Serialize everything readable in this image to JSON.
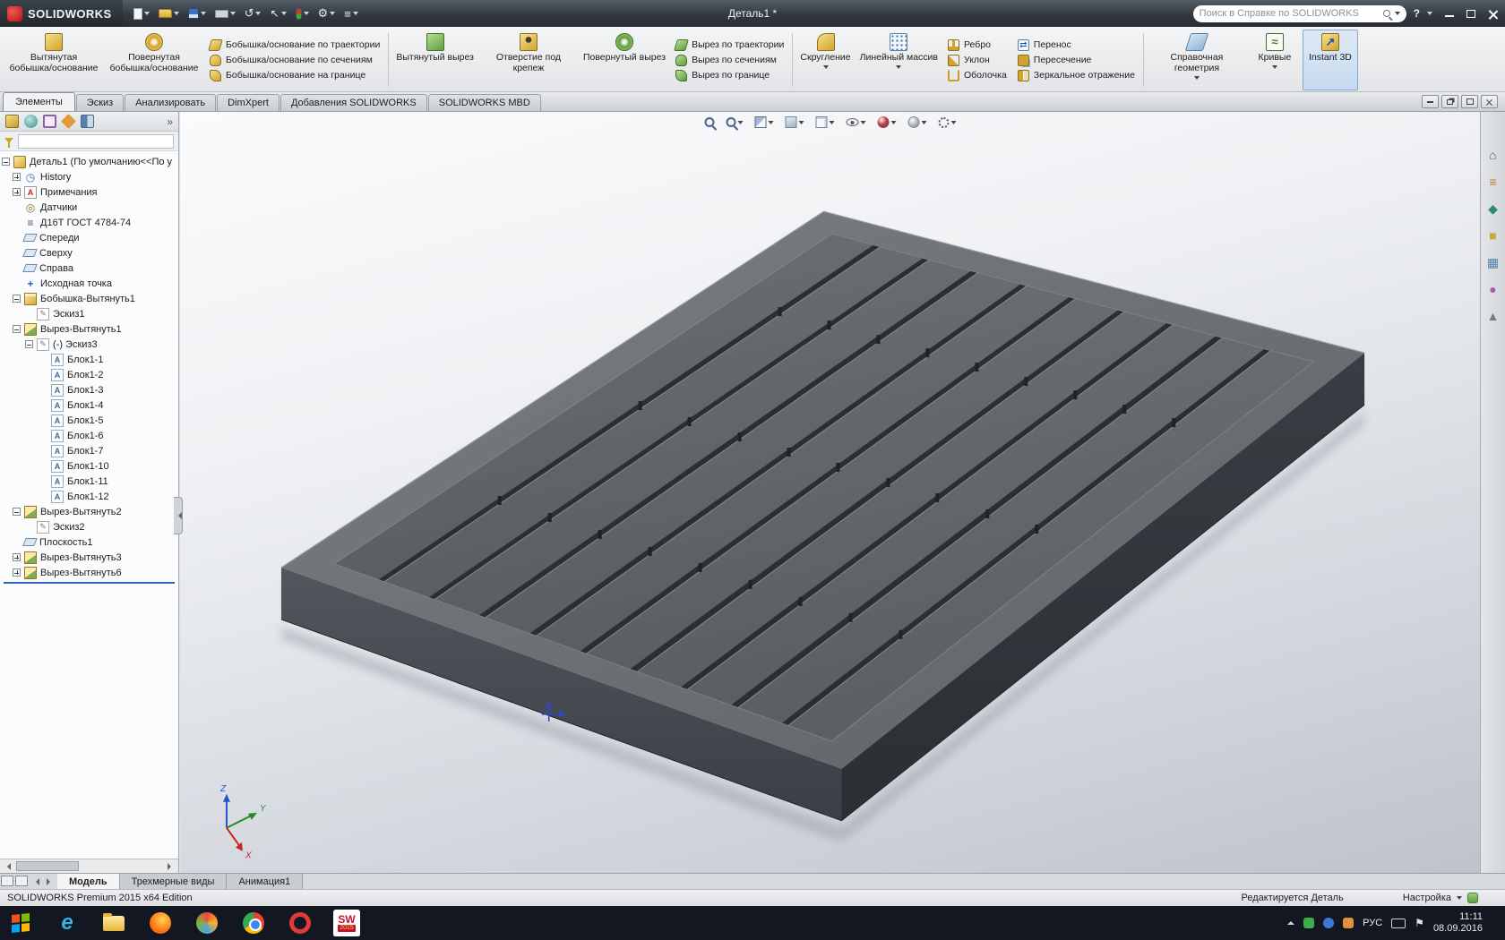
{
  "titlebar": {
    "app_name": "SOLIDWORKS",
    "doc_title": "Деталь1 *",
    "search_placeholder": "Поиск в Справке по SOLIDWORKS",
    "help": "?"
  },
  "ribbon": {
    "big": [
      "Вытянутая бобышка/основание",
      "Повернутая бобышка/основание",
      "Вытянутый вырез",
      "Отверстие под крепеж",
      "Повернутый вырез",
      "Скругление",
      "Линейный массив",
      "Справочная геометрия",
      "Кривые",
      "Instant 3D"
    ],
    "stacks": [
      [
        "Бобышка/основание по траектории",
        "Бобышка/основание по сечениям",
        "Бобышка/основание на границе"
      ],
      [
        "Вырез по траектории",
        "Вырез по сечениям",
        "Вырез по границе"
      ],
      [
        "Ребро",
        "Уклон",
        "Оболочка"
      ],
      [
        "Перенос",
        "Пересечение",
        "Зеркальное отражение"
      ]
    ]
  },
  "tabs": [
    "Элементы",
    "Эскиз",
    "Анализировать",
    "DimXpert",
    "Добавления SOLIDWORKS",
    "SOLIDWORKS MBD"
  ],
  "tree": {
    "root": "Деталь1 (По умолчанию<<По у",
    "items": [
      {
        "label": "History"
      },
      {
        "label": "Примечания"
      },
      {
        "label": "Датчики"
      },
      {
        "label": "Д16Т ГОСТ 4784-74"
      },
      {
        "label": "Спереди"
      },
      {
        "label": "Сверху"
      },
      {
        "label": "Справа"
      },
      {
        "label": "Исходная точка"
      },
      {
        "label": "Бобышка-Вытянуть1"
      },
      {
        "label": "Эскиз1"
      },
      {
        "label": "Вырез-Вытянуть1"
      },
      {
        "label": "(-) Эскиз3"
      },
      {
        "label": "Блок1-1"
      },
      {
        "label": "Блок1-2"
      },
      {
        "label": "Блок1-3"
      },
      {
        "label": "Блок1-4"
      },
      {
        "label": "Блок1-5"
      },
      {
        "label": "Блок1-6"
      },
      {
        "label": "Блок1-7"
      },
      {
        "label": "Блок1-10"
      },
      {
        "label": "Блок1-11"
      },
      {
        "label": "Блок1-12"
      },
      {
        "label": "Вырез-Вытянуть2"
      },
      {
        "label": "Эскиз2"
      },
      {
        "label": "Плоскость1"
      },
      {
        "label": "Вырез-Вытянуть3"
      },
      {
        "label": "Вырез-Вытянуть6"
      }
    ]
  },
  "triad": {
    "x": "X",
    "y": "Y",
    "z": "Z"
  },
  "model_tabs": [
    "Модель",
    "Трехмерные виды",
    "Анимация1"
  ],
  "status": {
    "left": "SOLIDWORKS Premium 2015 x64 Edition",
    "editing": "Редактируется Деталь",
    "customize": "Настройка"
  },
  "taskbar": {
    "lang": "РУС",
    "time": "11:11",
    "date": "08.09.2016",
    "sw_label": "SW",
    "sw_badge": "2015"
  },
  "icons": {
    "search": "magnifier",
    "filter": "funnel",
    "rebuild": "traffic-light",
    "window": [
      "minimize",
      "maximize",
      "close"
    ],
    "taskbar_apps": [
      "start",
      "internet-explorer",
      "file-explorer",
      "firefox",
      "media-player",
      "chrome",
      "opera",
      "solidworks-2015"
    ]
  },
  "colors": {
    "accent": "#2a6fb2",
    "rollback_bar": "#2f62c1",
    "model_gray": "#63676b",
    "taskbar_bg": "#131722",
    "gold_icon": "#d2a42e",
    "green_icon": "#5d9e3c"
  }
}
